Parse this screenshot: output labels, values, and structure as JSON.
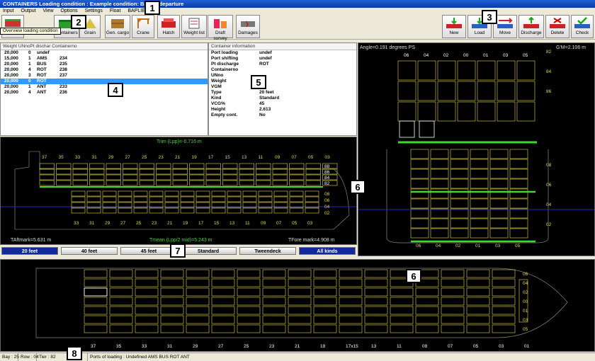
{
  "window": {
    "title": "CONTAINERS  Loading condition : Example condition: Ballast departure"
  },
  "menu": [
    "Input",
    "Output",
    "View",
    "Options",
    "Settings",
    "Float",
    "BAPLIE"
  ],
  "toolbar_left": [
    {
      "label": "",
      "icon": "overview-icon"
    },
    {
      "label": "Containers",
      "icon": "container-icon"
    },
    {
      "label": "Grain",
      "icon": "grain-icon"
    },
    {
      "label": "Gen. cargo",
      "icon": "crate-icon"
    },
    {
      "label": "Crane",
      "icon": "crane-icon"
    },
    {
      "label": "Hatch",
      "icon": "hatch-icon"
    },
    {
      "label": "Weight list",
      "icon": "weight-list-icon"
    },
    {
      "label": "Draft survey",
      "icon": "draft-icon"
    },
    {
      "label": "Damages",
      "icon": "damage-icon"
    }
  ],
  "tooltip": "Overview loading condition",
  "toolbar_right": [
    {
      "label": "New"
    },
    {
      "label": "Load"
    },
    {
      "label": "Move"
    },
    {
      "label": "Discharge"
    },
    {
      "label": "Delete"
    },
    {
      "label": "Check"
    }
  ],
  "container_list": {
    "header": "Weight    UNnoPt dischar Containerno",
    "rows": [
      {
        "weight": "20,000",
        "un": "0",
        "port": "undef",
        "no": "",
        "selected": false
      },
      {
        "weight": "15,000",
        "un": "1",
        "port": "AMS",
        "no": "234",
        "selected": false
      },
      {
        "weight": "20,000",
        "un": "1",
        "port": "BUS",
        "no": "235",
        "selected": false
      },
      {
        "weight": "20,000",
        "un": "4",
        "port": "ROT",
        "no": "238",
        "selected": false
      },
      {
        "weight": "20,000",
        "un": "3",
        "port": "ROT",
        "no": "237",
        "selected": false
      },
      {
        "weight": "20,000",
        "un": "0",
        "port": "ROT",
        "no": "",
        "selected": true
      },
      {
        "weight": "20,000",
        "un": "1",
        "port": "ANT",
        "no": "233",
        "selected": false
      },
      {
        "weight": "20,000",
        "un": "4",
        "port": "ANT",
        "no": "236",
        "selected": false
      }
    ]
  },
  "container_info": {
    "header": "Container information",
    "rows": [
      {
        "k": "Port loading",
        "v": "undef"
      },
      {
        "k": "Port shifting",
        "v": "undef"
      },
      {
        "k": "Pt discharge",
        "v": "ROT"
      },
      {
        "k": "Containerno",
        "v": ""
      },
      {
        "k": "UNno",
        "v": ""
      },
      {
        "k": "Weight",
        "v": ""
      },
      {
        "k": "VGM",
        "v": ""
      },
      {
        "k": "Type",
        "v": "20 feet"
      },
      {
        "k": "Kind",
        "v": "Standard"
      },
      {
        "k": "VCG%",
        "v": "45"
      },
      {
        "k": "Height",
        "v": "2.613"
      },
      {
        "k": "Empty cont.",
        "v": "No"
      }
    ]
  },
  "side_view": {
    "trim": "Trim (Lpp)=-0.716 m",
    "taft": "TAftmark=5.631 m",
    "tmean": "Tmean (Lpp/2 mid)=5.243 m",
    "tfore": "TFore mark=4.908 m",
    "bays_top": [
      "37",
      "35",
      "33",
      "31",
      "29",
      "27",
      "25",
      "23",
      "21",
      "19",
      "17",
      "15",
      "13",
      "11",
      "09",
      "07",
      "05",
      "03"
    ],
    "bays_bottom": [
      "33",
      "31",
      "29",
      "27",
      "25",
      "23",
      "21",
      "19",
      "17",
      "15",
      "13",
      "11",
      "09",
      "07",
      "05",
      "03"
    ],
    "tiers_deck": [
      "88",
      "86",
      "84",
      "82"
    ],
    "tiers_hold": [
      "08",
      "06",
      "04",
      "02"
    ]
  },
  "section_view": {
    "angle": "Angle=0.191 degrees PS",
    "gm": "G'M=2.106 m",
    "rows_top": [
      "06",
      "04",
      "02",
      "00",
      "01",
      "03",
      "05"
    ],
    "tiers_deck": [
      "86",
      "84",
      "82"
    ],
    "tiers_hold": [
      "08",
      "06",
      "04",
      "02"
    ],
    "rows_bottom": [
      "06",
      "04",
      "02",
      "01",
      "03",
      "05"
    ]
  },
  "kind_buttons": [
    {
      "label": "20 feet",
      "on": true
    },
    {
      "label": "40 feet",
      "on": false
    },
    {
      "label": "45 feet",
      "on": false
    },
    {
      "label": "Standard",
      "on": false
    },
    {
      "label": "Tweendeck",
      "on": false
    },
    {
      "label": "All kinds",
      "on": true
    }
  ],
  "plan_view": {
    "bays": [
      "37",
      "35",
      "33",
      "31",
      "29",
      "27",
      "25",
      "23",
      "21",
      "19",
      "17x15",
      "13",
      "11",
      "09",
      "07",
      "05",
      "03",
      "01"
    ],
    "rows": [
      "06",
      "04",
      "02",
      "00",
      "01",
      "03",
      "05"
    ]
  },
  "status": {
    "bay": "Bay : 25",
    "row": "Row : 04",
    "tier": "Tier : 82",
    "ports": "Ports of loading :  Undefined AMS BUS ROT ANT"
  },
  "callouts": [
    "1",
    "2",
    "3",
    "4",
    "5",
    "6",
    "7",
    "8"
  ],
  "colors": {
    "yellow": "#e6d64a",
    "green": "#3ddc2a",
    "blue": "#1010a0",
    "waterline": "#2222cc"
  }
}
